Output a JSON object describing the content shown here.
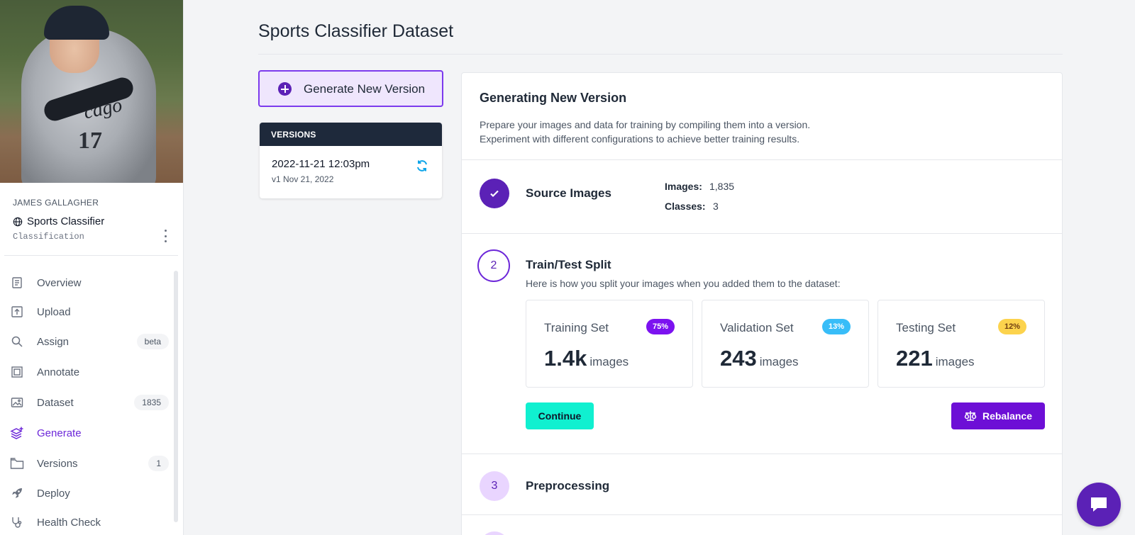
{
  "project": {
    "owner": "JAMES GALLAGHER",
    "name": "Sports Classifier",
    "type": "Classification"
  },
  "sidebar": {
    "items": [
      {
        "label": "Overview",
        "icon": "book-icon",
        "badge": ""
      },
      {
        "label": "Upload",
        "icon": "upload-icon",
        "badge": ""
      },
      {
        "label": "Assign",
        "icon": "search-icon",
        "badge": "beta"
      },
      {
        "label": "Annotate",
        "icon": "annotate-icon",
        "badge": ""
      },
      {
        "label": "Dataset",
        "icon": "images-icon",
        "badge": "1835"
      },
      {
        "label": "Generate",
        "icon": "layers-plus-icon",
        "badge": "",
        "active": true
      },
      {
        "label": "Versions",
        "icon": "folder-icon",
        "badge": "1"
      },
      {
        "label": "Deploy",
        "icon": "rocket-icon",
        "badge": ""
      },
      {
        "label": "Health Check",
        "icon": "stethoscope-icon",
        "badge": ""
      }
    ]
  },
  "main": {
    "title": "Sports Classifier Dataset",
    "generate_button": "Generate New Version",
    "versions": {
      "header": "VERSIONS",
      "items": [
        {
          "title": "2022-11-21 12:03pm",
          "subtitle": "v1 Nov 21, 2022"
        }
      ]
    },
    "panel": {
      "title": "Generating New Version",
      "desc_line1": "Prepare your images and data for training by compiling them into a version.",
      "desc_line2": "Experiment with different configurations to achieve better training results.",
      "steps": {
        "source": {
          "title": "Source Images",
          "images_label": "Images:",
          "images_value": "1,835",
          "classes_label": "Classes:",
          "classes_value": "3"
        },
        "split": {
          "number": "2",
          "title": "Train/Test Split",
          "desc": "Here is how you split your images when you added them to the dataset:",
          "cards": [
            {
              "name": "Training Set",
              "badge": "75%",
              "count": "1.4k",
              "unit": "images",
              "badge_bg": "#7c12f0",
              "badge_fg": "#ffffff"
            },
            {
              "name": "Validation Set",
              "badge": "13%",
              "count": "243",
              "unit": "images",
              "badge_bg": "#38bdf8",
              "badge_fg": "#ffffff"
            },
            {
              "name": "Testing Set",
              "badge": "12%",
              "count": "221",
              "unit": "images",
              "badge_bg": "#fcd34d",
              "badge_fg": "#713f12"
            }
          ],
          "continue_label": "Continue",
          "rebalance_label": "Rebalance"
        },
        "preprocessing": {
          "number": "3",
          "title": "Preprocessing"
        }
      }
    }
  },
  "colors": {
    "accent": "#6d28d9",
    "continue": "#10f0d0",
    "rebalance": "#6d0fd6"
  }
}
